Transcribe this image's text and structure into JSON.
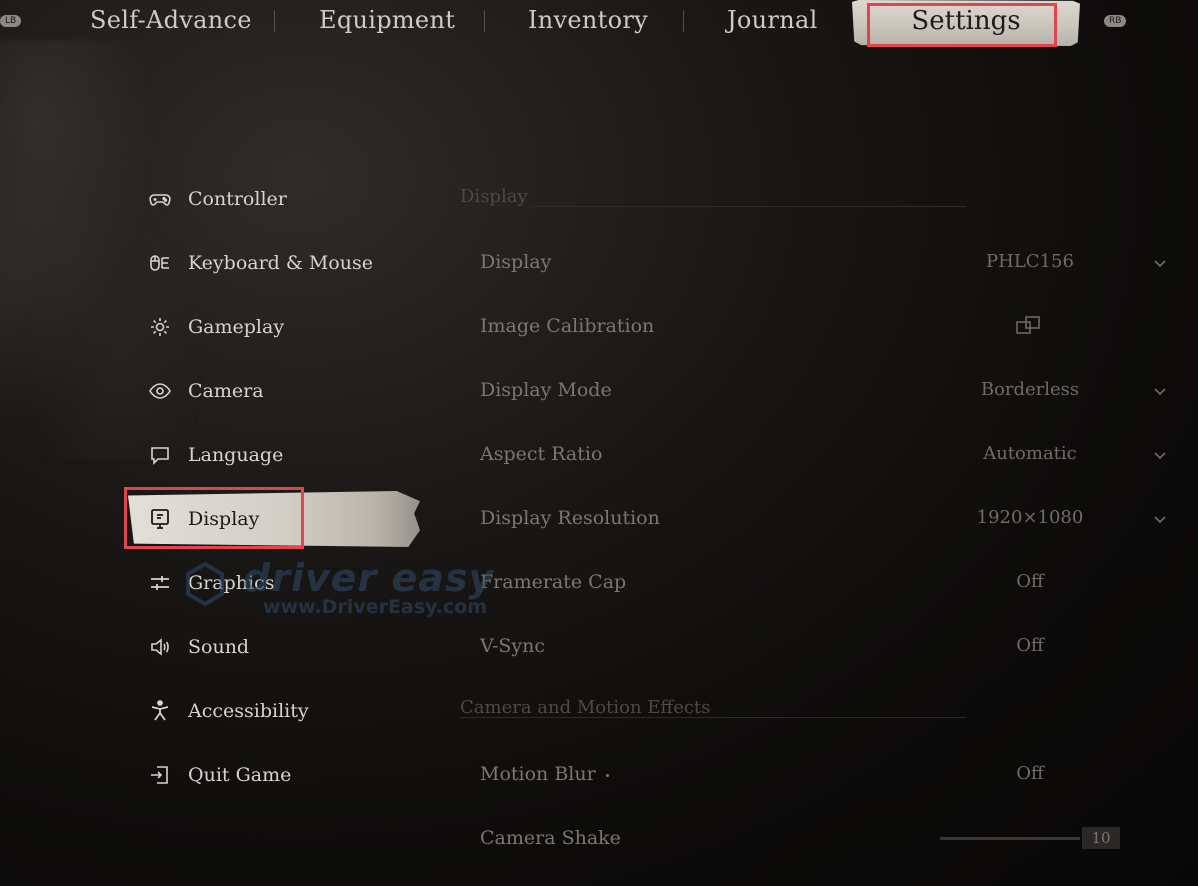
{
  "topbar": {
    "lb_hint": "LB",
    "rb_hint": "RB",
    "tabs": [
      {
        "label": "Self-Advance"
      },
      {
        "label": "Equipment"
      },
      {
        "label": "Inventory"
      },
      {
        "label": "Journal"
      },
      {
        "label": "Settings"
      }
    ],
    "active_tab": "Settings"
  },
  "menu": {
    "active_item": "Display",
    "items": [
      {
        "label": "Controller",
        "icon": "gamepad-icon"
      },
      {
        "label": "Keyboard & Mouse",
        "icon": "keyboard-mouse-icon"
      },
      {
        "label": "Gameplay",
        "icon": "gear-icon"
      },
      {
        "label": "Camera",
        "icon": "eye-icon"
      },
      {
        "label": "Language",
        "icon": "chat-bubble-icon"
      },
      {
        "label": "Display",
        "icon": "monitor-icon"
      },
      {
        "label": "Graphics",
        "icon": "sliders-icon"
      },
      {
        "label": "Sound",
        "icon": "speaker-icon"
      },
      {
        "label": "Accessibility",
        "icon": "person-icon"
      },
      {
        "label": "Quit Game",
        "icon": "exit-icon"
      }
    ]
  },
  "panel": {
    "sections": [
      {
        "title": "Display",
        "rows": [
          {
            "name": "Display",
            "value": "PHLC156",
            "control": "dropdown"
          },
          {
            "name": "Image Calibration",
            "value": "",
            "control": "external-link"
          },
          {
            "name": "Display Mode",
            "value": "Borderless",
            "control": "dropdown"
          },
          {
            "name": "Aspect Ratio",
            "value": "Automatic",
            "control": "dropdown"
          },
          {
            "name": "Display Resolution",
            "value": "1920×1080",
            "control": "dropdown"
          },
          {
            "name": "Framerate Cap",
            "value": "Off",
            "control": "toggle"
          },
          {
            "name": "V-Sync",
            "value": "Off",
            "control": "toggle"
          }
        ]
      },
      {
        "title": "Camera and Motion Effects",
        "rows": [
          {
            "name": "Motion Blur",
            "value": "Off",
            "control": "toggle"
          },
          {
            "name": "Camera Shake",
            "value": "10",
            "control": "slider"
          }
        ]
      }
    ]
  },
  "watermark": {
    "brand": "driver easy",
    "url": "www.DriverEasy.com"
  },
  "colors": {
    "highlight_box": "#e0444e",
    "active_tab_bg": "#d4d0c8",
    "background": "#0c0b0a"
  }
}
